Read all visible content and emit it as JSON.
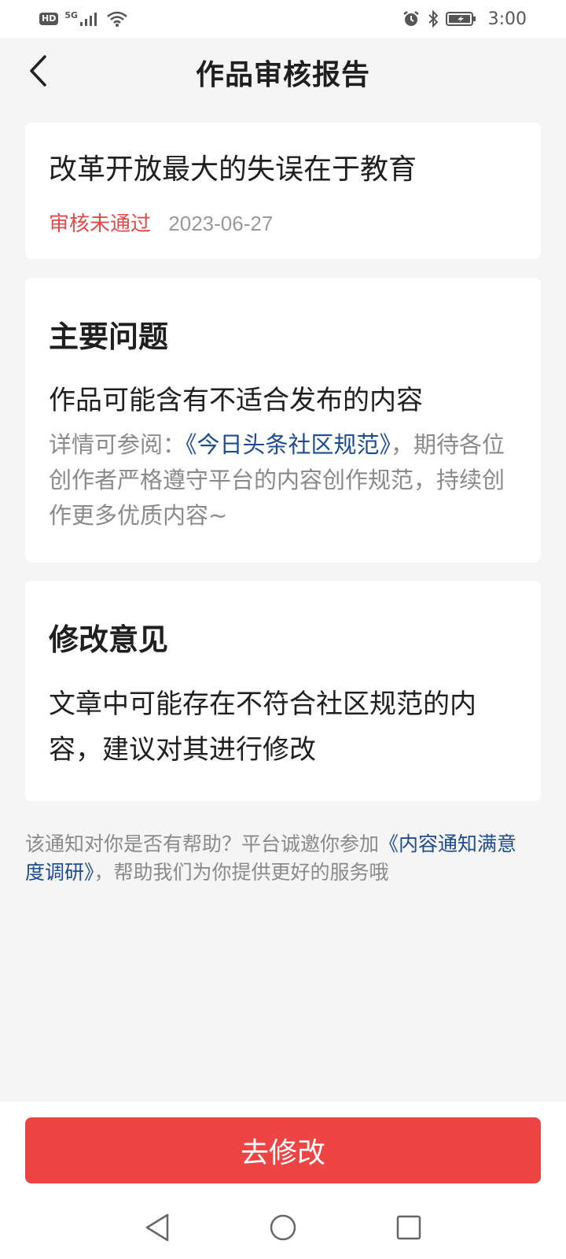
{
  "status_bar": {
    "left_badge": "HD",
    "network": "5G",
    "time": "3:00",
    "icons": [
      "signal-icon",
      "wifi-icon",
      "alarm-icon",
      "bluetooth-icon",
      "battery-icon"
    ]
  },
  "header": {
    "title": "作品审核报告",
    "back_icon": "chevron-left-icon"
  },
  "article": {
    "title": "改革开放最大的失误在于教育",
    "status": "审核未通过",
    "date": "2023-06-27"
  },
  "main_issue": {
    "heading": "主要问题",
    "issue": "作品可能含有不适合发布的内容",
    "detail_prefix": "详情可参阅：",
    "detail_link": "《今日头条社区规范》",
    "detail_suffix": "，期待各位创作者严格遵守平台的内容创作规范，持续创作更多优质内容~"
  },
  "advice": {
    "heading": "修改意见",
    "text": "文章中可能存在不符合社区规范的内容，建议对其进行修改"
  },
  "feedback": {
    "prefix": "该通知对你是否有帮助？平台诚邀你参加",
    "link": "《内容通知满意度调研》",
    "suffix": "，帮助我们为你提供更好的服务哦"
  },
  "actions": {
    "primary_label": "去修改"
  },
  "colors": {
    "accent_red": "#ef4444",
    "status_red": "#e04a4a",
    "link_blue": "#1d4b8f"
  }
}
